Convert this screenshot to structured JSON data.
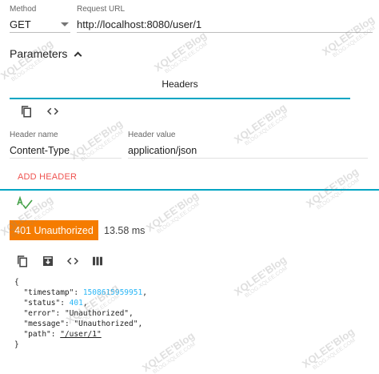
{
  "request": {
    "method_label": "Method",
    "method_value": "GET",
    "url_label": "Request URL",
    "url_value": "http://localhost:8080/user/1"
  },
  "parameters": {
    "label": "Parameters"
  },
  "tabs": [
    {
      "label": "Headers",
      "active": true
    }
  ],
  "headers_toolbar": {
    "icons": [
      "copy-icon",
      "code-icon"
    ]
  },
  "header_row": {
    "name_label": "Header name",
    "name_value": "Content-Type",
    "value_label": "Header value",
    "value_value": "application/json"
  },
  "add_header": {
    "label": "ADD HEADER"
  },
  "response": {
    "status_text": "401 Unauthorized",
    "time": "13.58 ms",
    "toolbar_icons": [
      "copy-icon",
      "download-icon",
      "code-icon",
      "columns-icon"
    ],
    "json_open": "{",
    "json_close": "}",
    "body": [
      {
        "key": "\"timestamp\"",
        "value": "1508615959951",
        "type": "number",
        "comma": ","
      },
      {
        "key": "\"status\"",
        "value": "401",
        "type": "number",
        "comma": ","
      },
      {
        "key": "\"error\"",
        "value": "\"Unauthorized\"",
        "type": "string",
        "comma": ","
      },
      {
        "key": "\"message\"",
        "value": "\"Unauthorized\"",
        "type": "string",
        "comma": ","
      },
      {
        "key": "\"path\"",
        "value": "\"/user/1\"",
        "type": "link",
        "comma": ""
      }
    ]
  },
  "watermark": {
    "title": "XQLEE'Blog",
    "subtitle": "BLOG.XQLEE.COM"
  },
  "colors": {
    "accent": "#00a5c3",
    "status_error": "#f57c00",
    "add_header": "#ef5350",
    "json_number": "#29b6f6"
  }
}
